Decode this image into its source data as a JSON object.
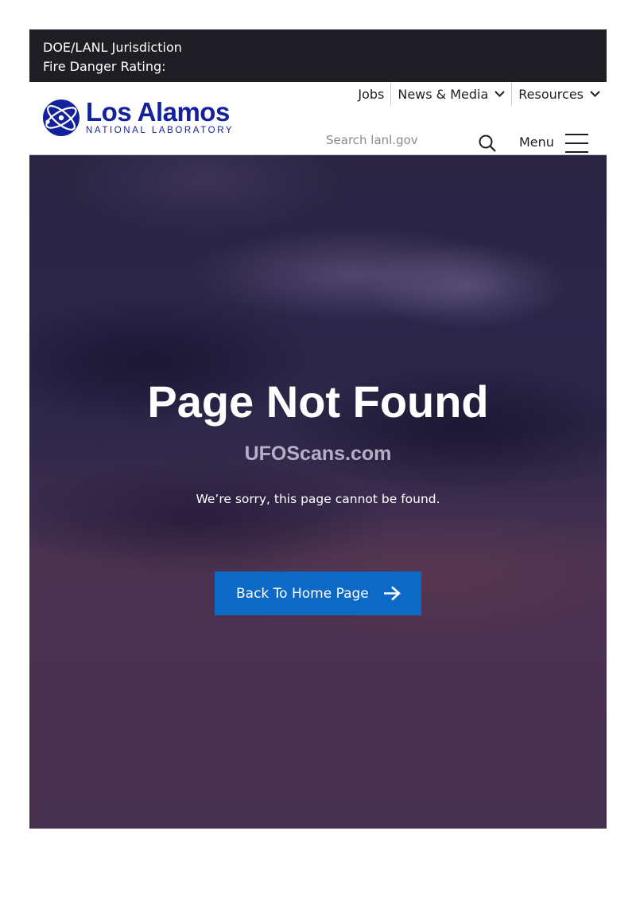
{
  "fire_banner": {
    "line1": "DOE/LANL Jurisdiction",
    "line2": "Fire Danger Rating:"
  },
  "logo": {
    "name": "Los Alamos",
    "subtitle": "NATIONAL LABORATORY",
    "color": "#13219a"
  },
  "topnav": {
    "items": [
      {
        "label": "Jobs",
        "has_dropdown": false
      },
      {
        "label": "News & Media",
        "has_dropdown": true
      },
      {
        "label": "Resources",
        "has_dropdown": true
      }
    ]
  },
  "search": {
    "placeholder": "Search lanl.gov",
    "icon": "search-icon"
  },
  "menu": {
    "label": "Menu",
    "icon": "hamburger-icon"
  },
  "hero": {
    "title": "Page Not Found",
    "watermark": "UFOScans.com",
    "subtitle": "We’re sorry, this page cannot be found.",
    "button_label": "Back To Home Page",
    "button_icon": "arrow-right-icon",
    "button_color": "#0c6ac6"
  }
}
